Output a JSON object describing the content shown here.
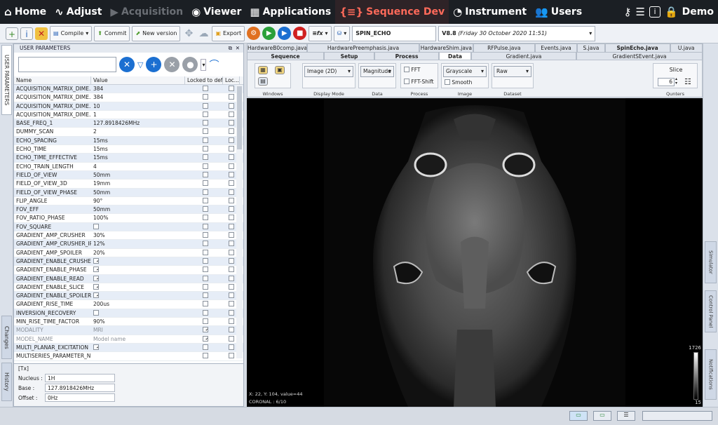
{
  "nav": {
    "home": "Home",
    "adjust": "Adjust",
    "acquisition": "Acquisition",
    "viewer": "Viewer",
    "applications": "Applications",
    "sequence_dev": "Sequence Dev",
    "instrument": "Instrument",
    "users": "Users",
    "user": "Demo"
  },
  "toolbar": {
    "compile": "Compile",
    "commit": "Commit",
    "new_version": "New version",
    "export": "Export",
    "sequence_name": "SPIN_ECHO",
    "version": "V8.8",
    "version_date": "(Friday 30 October 2020 11:51)"
  },
  "params": {
    "panel_title": "USER PARAMETERS",
    "col_name": "Name",
    "col_value": "Value",
    "col_locked": "Locked to def...",
    "col_loc2": "Loc...",
    "rows": [
      {
        "name": "ACQUISITION_MATRIX_DIME...",
        "value": "384",
        "locked": false,
        "loc": false
      },
      {
        "name": "ACQUISITION_MATRIX_DIME...",
        "value": "384",
        "locked": false,
        "loc": false
      },
      {
        "name": "ACQUISITION_MATRIX_DIME...",
        "value": "10",
        "locked": false,
        "loc": false
      },
      {
        "name": "ACQUISITION_MATRIX_DIME...",
        "value": "1",
        "locked": false,
        "loc": false
      },
      {
        "name": "BASE_FREQ_1",
        "value": "127.8918426MHz",
        "locked": false,
        "loc": false
      },
      {
        "name": "DUMMY_SCAN",
        "value": "2",
        "locked": false,
        "loc": false
      },
      {
        "name": "ECHO_SPACING",
        "value": "15ms",
        "locked": false,
        "loc": false
      },
      {
        "name": "ECHO_TIME",
        "value": "15ms",
        "locked": false,
        "loc": false
      },
      {
        "name": "ECHO_TIME_EFFECTIVE",
        "value": "15ms",
        "locked": false,
        "loc": false
      },
      {
        "name": "ECHO_TRAIN_LENGTH",
        "value": "4",
        "locked": false,
        "loc": false
      },
      {
        "name": "FIELD_OF_VIEW",
        "value": "50mm",
        "locked": false,
        "loc": false
      },
      {
        "name": "FIELD_OF_VIEW_3D",
        "value": "19mm",
        "locked": false,
        "loc": false
      },
      {
        "name": "FIELD_OF_VIEW_PHASE",
        "value": "50mm",
        "locked": false,
        "loc": false
      },
      {
        "name": "FLIP_ANGLE",
        "value": "90°",
        "locked": false,
        "loc": false
      },
      {
        "name": "FOV_EFF",
        "value": "50mm",
        "locked": false,
        "loc": false
      },
      {
        "name": "FOV_RATIO_PHASE",
        "value": "100%",
        "locked": false,
        "loc": false
      },
      {
        "name": "FOV_SQUARE",
        "value": "",
        "checkbox": false,
        "locked": false,
        "loc": false
      },
      {
        "name": "GRADIENT_AMP_CRUSHER",
        "value": "30%",
        "locked": false,
        "loc": false
      },
      {
        "name": "GRADIENT_AMP_CRUSHER_IR",
        "value": "12%",
        "locked": false,
        "loc": false
      },
      {
        "name": "GRADIENT_AMP_SPOILER",
        "value": "20%",
        "locked": false,
        "loc": false
      },
      {
        "name": "GRADIENT_ENABLE_CRUSHER...",
        "value": "",
        "checkbox": true,
        "locked": false,
        "loc": false
      },
      {
        "name": "GRADIENT_ENABLE_PHASE",
        "value": "",
        "checkbox": true,
        "locked": false,
        "loc": false
      },
      {
        "name": "GRADIENT_ENABLE_READ",
        "value": "",
        "checkbox": true,
        "locked": false,
        "loc": false
      },
      {
        "name": "GRADIENT_ENABLE_SLICE",
        "value": "",
        "checkbox": true,
        "locked": false,
        "loc": false
      },
      {
        "name": "GRADIENT_ENABLE_SPOILER",
        "value": "",
        "checkbox": true,
        "locked": false,
        "loc": false
      },
      {
        "name": "GRADIENT_RISE_TIME",
        "value": "200us",
        "locked": false,
        "loc": false
      },
      {
        "name": "INVERSION_RECOVERY",
        "value": "",
        "checkbox": false,
        "locked": false,
        "loc": false
      },
      {
        "name": "MIN_RISE_TIME_FACTOR",
        "value": "90%",
        "locked": false,
        "loc": false
      },
      {
        "name": "MODALITY",
        "value": "MRI",
        "locked": true,
        "loc": false,
        "dim": true
      },
      {
        "name": "MODEL_NAME",
        "value": "Model name",
        "locked": true,
        "loc": false,
        "dim": true
      },
      {
        "name": "MULTI_PLANAR_EXCITATION",
        "value": "",
        "checkbox": true,
        "locked": false,
        "loc": false
      },
      {
        "name": "MULTISERIES_PARAMETER_N...",
        "value": "",
        "locked": false,
        "loc": false
      }
    ]
  },
  "tx": {
    "title": "[Tx]",
    "nucleus_label": "Nucleus :",
    "nucleus_value": "1H",
    "base_label": "Base :",
    "base_value": "127.8918426MHz",
    "offset_label": "Offset :",
    "offset_value": "0Hz"
  },
  "side_tabs": {
    "user_parameters": "USER PARAMETERS",
    "changes": "Changes",
    "history": "History",
    "simulator": "Simulator",
    "control_panel": "Control Panel",
    "notifications": "Notifications"
  },
  "file_tabs_row1": [
    "HardwareB0comp.java",
    "HardwarePreemphasis.java",
    "HardwareShim.java",
    "RFPulse.java",
    "Events.java",
    "S.java",
    "SpinEcho.java",
    "U.java"
  ],
  "file_tabs_row2": [
    "Sequence",
    "Setup",
    "Process",
    "Data",
    "Gradient.java",
    "GradientSEvent.java"
  ],
  "controls": {
    "windows_label": "Windows",
    "display_mode": "Image (2D)",
    "display_mode_label": "Display Mode",
    "data_sel": "Magnitude",
    "data_label": "Data",
    "fft": "FFT",
    "fft_shift": "FFT-Shift",
    "process_label": "Process",
    "color_map": "Grayscale",
    "smooth": "Smooth",
    "image_label": "Image",
    "dataset_sel": "Raw",
    "dataset_label": "Dataset",
    "slice_label": "Slice",
    "slice_value": "6",
    "qunters_label": "Qunters"
  },
  "viewer": {
    "cursor_info": "X: 22, Y: 104, value=44",
    "orientation": "CORONAL : 6/10",
    "scale_max": "1726",
    "scale_min": "15"
  },
  "colors": {
    "accent": "#ff6a5a",
    "topbar": "#1b1f24",
    "blue_button": "#1b6fd1"
  }
}
